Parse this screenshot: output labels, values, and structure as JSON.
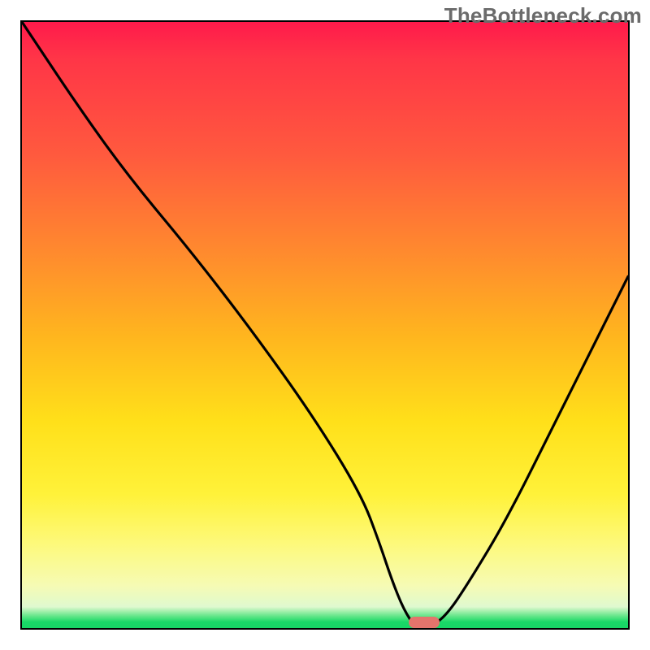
{
  "watermark": "TheBottleneck.com",
  "chart_data": {
    "type": "line",
    "title": "",
    "xlabel": "",
    "ylabel": "",
    "xlim": [
      0,
      100
    ],
    "ylim": [
      0,
      100
    ],
    "x": [
      0,
      10,
      18,
      28,
      38,
      48,
      56,
      59,
      61,
      63,
      65,
      67,
      70,
      74,
      80,
      88,
      96,
      100
    ],
    "values": [
      100,
      85,
      74,
      62,
      49,
      35,
      22,
      14,
      8,
      3,
      0,
      0,
      2,
      8,
      18,
      34,
      50,
      58
    ],
    "marker": {
      "x_center": 66,
      "width_pct": 5,
      "y": 0
    },
    "grid": false,
    "legend": false
  },
  "colors": {
    "curve": "#000000",
    "marker": "#e4746c",
    "border": "#000000"
  }
}
